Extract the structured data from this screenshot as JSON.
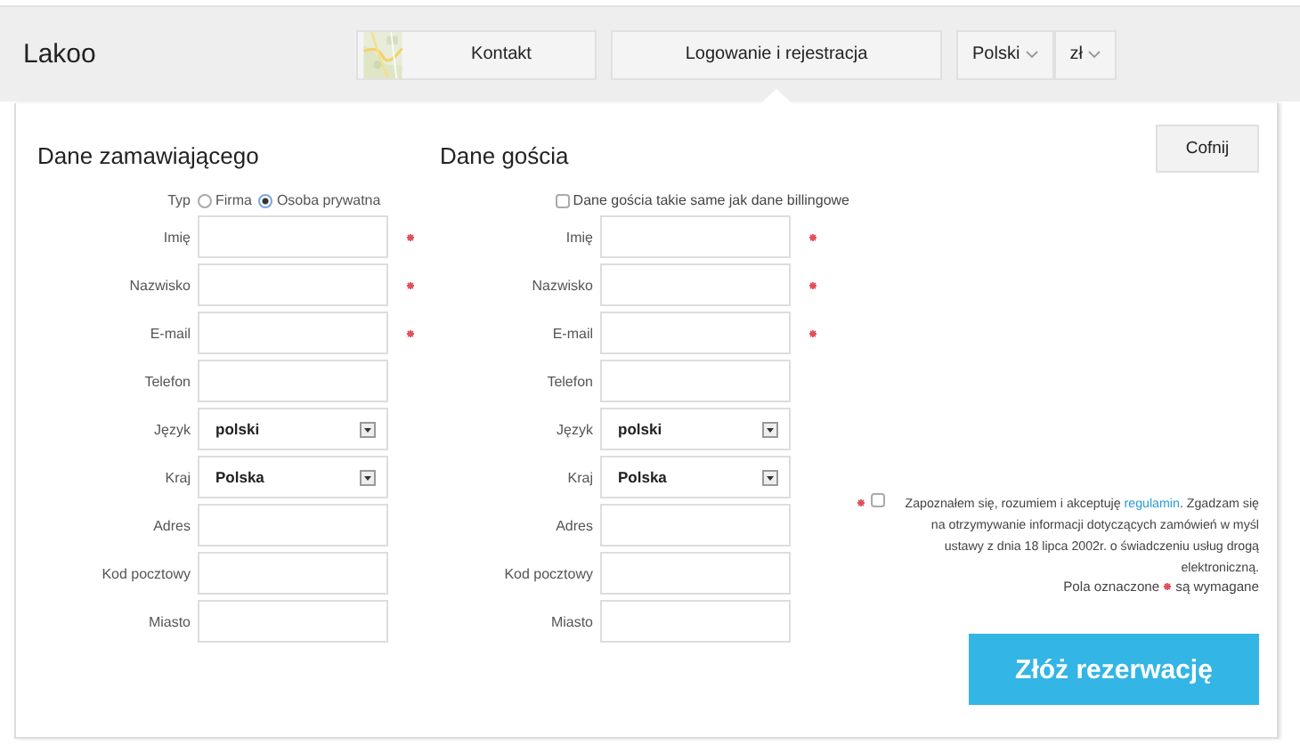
{
  "header": {
    "logo": "Lakoo",
    "nav": [
      {
        "kind": "picture-button",
        "label": "Kontakt",
        "selected": false
      },
      {
        "kind": "button",
        "label": "Logowanie i rejestracja",
        "selected": true
      },
      {
        "kind": "dropdown",
        "label": "Polski"
      },
      {
        "kind": "dropdown",
        "label": "zł"
      }
    ]
  },
  "back_button": "Cofnij",
  "columns": [
    {
      "title": "Dane zamawiającego",
      "type_label": "Typ",
      "type_options": [
        {
          "label": "Firma",
          "selected": false
        },
        {
          "label": "Osoba prywatna",
          "selected": true
        }
      ],
      "fields": [
        {
          "label": "Imię",
          "kind": "text",
          "required": true
        },
        {
          "label": "Nazwisko",
          "kind": "text",
          "required": true
        },
        {
          "label": "E-mail",
          "kind": "text",
          "required": true
        },
        {
          "label": "Telefon",
          "kind": "text",
          "required": false
        },
        {
          "label": "Język",
          "kind": "select",
          "value": "polski",
          "required": false
        },
        {
          "label": "Kraj",
          "kind": "select",
          "value": "Polska",
          "required": false
        },
        {
          "label": "Adres",
          "kind": "text",
          "required": false
        },
        {
          "label": "Kod pocztowy",
          "kind": "text",
          "required": false
        },
        {
          "label": "Miasto",
          "kind": "text",
          "required": false
        }
      ]
    },
    {
      "title": "Dane gościa",
      "same_as_billing": {
        "label": "Dane gościa takie same jak dane billingowe",
        "checked": false
      },
      "fields": [
        {
          "label": "Imię",
          "kind": "text",
          "required": true
        },
        {
          "label": "Nazwisko",
          "kind": "text",
          "required": true
        },
        {
          "label": "E-mail",
          "kind": "text",
          "required": true
        },
        {
          "label": "Telefon",
          "kind": "text",
          "required": false
        },
        {
          "label": "Język",
          "kind": "select",
          "value": "polski",
          "required": false
        },
        {
          "label": "Kraj",
          "kind": "select",
          "value": "Polska",
          "required": false
        },
        {
          "label": "Adres",
          "kind": "text",
          "required": false
        },
        {
          "label": "Kod pocztowy",
          "kind": "text",
          "required": false
        },
        {
          "label": "Miasto",
          "kind": "text",
          "required": false
        }
      ]
    }
  ],
  "terms": {
    "checked": false,
    "required": true,
    "before": "Zapoznałem się, rozumiem i akceptuję",
    "link": "regulamin",
    "after": ". Zgadzam się na otrzymywanie informacji dotyczących zamówień w myśl ustawy z dnia 18 lipca 2002r. o świadczeniu usług drogą elektroniczną."
  },
  "required_note": {
    "before": "Pola oznaczone",
    "after": "są wymagane"
  },
  "submit_button": "Złóż rezerwację"
}
